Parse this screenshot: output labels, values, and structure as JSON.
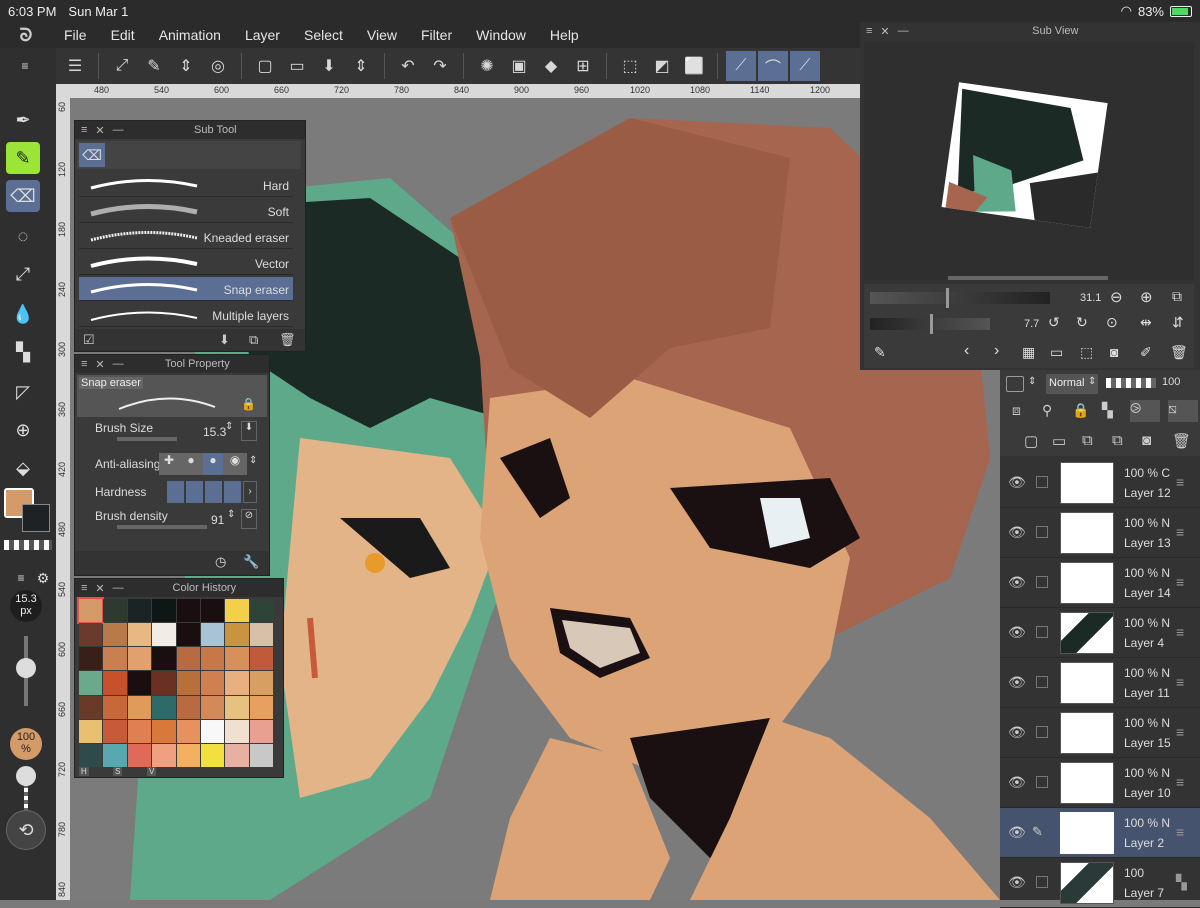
{
  "status": {
    "time": "6:03 PM",
    "date": "Sun Mar 1",
    "battery": "83%"
  },
  "menu": [
    "File",
    "Edit",
    "Animation",
    "Layer",
    "Select",
    "View",
    "Filter",
    "Window",
    "Help"
  ],
  "ruler_h": [
    "480",
    "540",
    "600",
    "660",
    "720",
    "780",
    "840",
    "900",
    "960",
    "1020",
    "1080",
    "1140",
    "1200"
  ],
  "ruler_v": [
    "60",
    "120",
    "180",
    "240",
    "300",
    "360",
    "420",
    "480",
    "540",
    "600",
    "660",
    "720",
    "780",
    "840"
  ],
  "subtool": {
    "title": "Sub Tool",
    "brushes": [
      "Hard",
      "Soft",
      "Kneaded eraser",
      "Vector",
      "Snap eraser",
      "Multiple layers"
    ]
  },
  "toolprop": {
    "title": "Tool Property",
    "tool_name": "Snap eraser",
    "brush_size_label": "Brush Size",
    "brush_size_value": "15.3",
    "anti_aliasing_label": "Anti-aliasing",
    "hardness_label": "Hardness",
    "density_label": "Brush density",
    "density_value": "91"
  },
  "colorhist": {
    "title": "Color History",
    "hsv": [
      "H",
      "S",
      "V"
    ],
    "colors": [
      "#d49a68",
      "#2e3a30",
      "#1a2424",
      "#0e1616",
      "#1a0e10",
      "#1a0e10",
      "#f2d04a",
      "#2e4438",
      "#6a3a2c",
      "#b87a48",
      "#e8b882",
      "#f2ece6",
      "#1a0e10",
      "#a8c4d4",
      "#c89440",
      "#d8c0a8",
      "#3a1e1a",
      "#c88050",
      "#e0a070",
      "#1a0e10",
      "#b86a40",
      "#c87848",
      "#d8905a",
      "#c05a3a",
      "#6aaa8a",
      "#c8502a",
      "#1a0e10",
      "#6a3022",
      "#b8703a",
      "#d08050",
      "#e8b080",
      "#d8a060",
      "#6a3a28",
      "#c86838",
      "#e09a5a",
      "#2e6a6a",
      "#b86a40",
      "#d48a58",
      "#e8c080",
      "#e8a060",
      "#e8c070",
      "#c85a3a",
      "#e08050",
      "#d8783a",
      "#e89060",
      "#f8f8f8",
      "#f0e0d0",
      "#e8a090",
      "#2e4a4a",
      "#58a8b0",
      "#e06a5a",
      "#f0a080",
      "#f2b060",
      "#f2e040",
      "#e8b0a0",
      "#c8c8c8"
    ]
  },
  "subview": {
    "title": "Sub View",
    "zoom": "31.1",
    "angle": "7.7"
  },
  "layerpanel": {
    "blend_mode": "Normal",
    "opacity": "100"
  },
  "layers": [
    {
      "opacity": "100 %",
      "mode": "C",
      "name": "Layer 12"
    },
    {
      "opacity": "100 %",
      "mode": "N",
      "name": "Layer 13"
    },
    {
      "opacity": "100 %",
      "mode": "N",
      "name": "Layer 14"
    },
    {
      "opacity": "100 %",
      "mode": "N",
      "name": "Layer 4"
    },
    {
      "opacity": "100 %",
      "mode": "N",
      "name": "Layer 11"
    },
    {
      "opacity": "100 %",
      "mode": "N",
      "name": "Layer 15"
    },
    {
      "opacity": "100 %",
      "mode": "N",
      "name": "Layer 10"
    },
    {
      "opacity": "100 %",
      "mode": "N",
      "name": "Layer 2"
    },
    {
      "opacity": "100",
      "mode": "",
      "name": "Layer 7"
    }
  ],
  "left": {
    "brush_px": "15.3",
    "brush_unit": "px",
    "opacity": "100",
    "opacity_unit": "%"
  },
  "colors": {
    "main": "#d49a68",
    "sub": "#1e2224",
    "accent": "#5b6e94"
  }
}
